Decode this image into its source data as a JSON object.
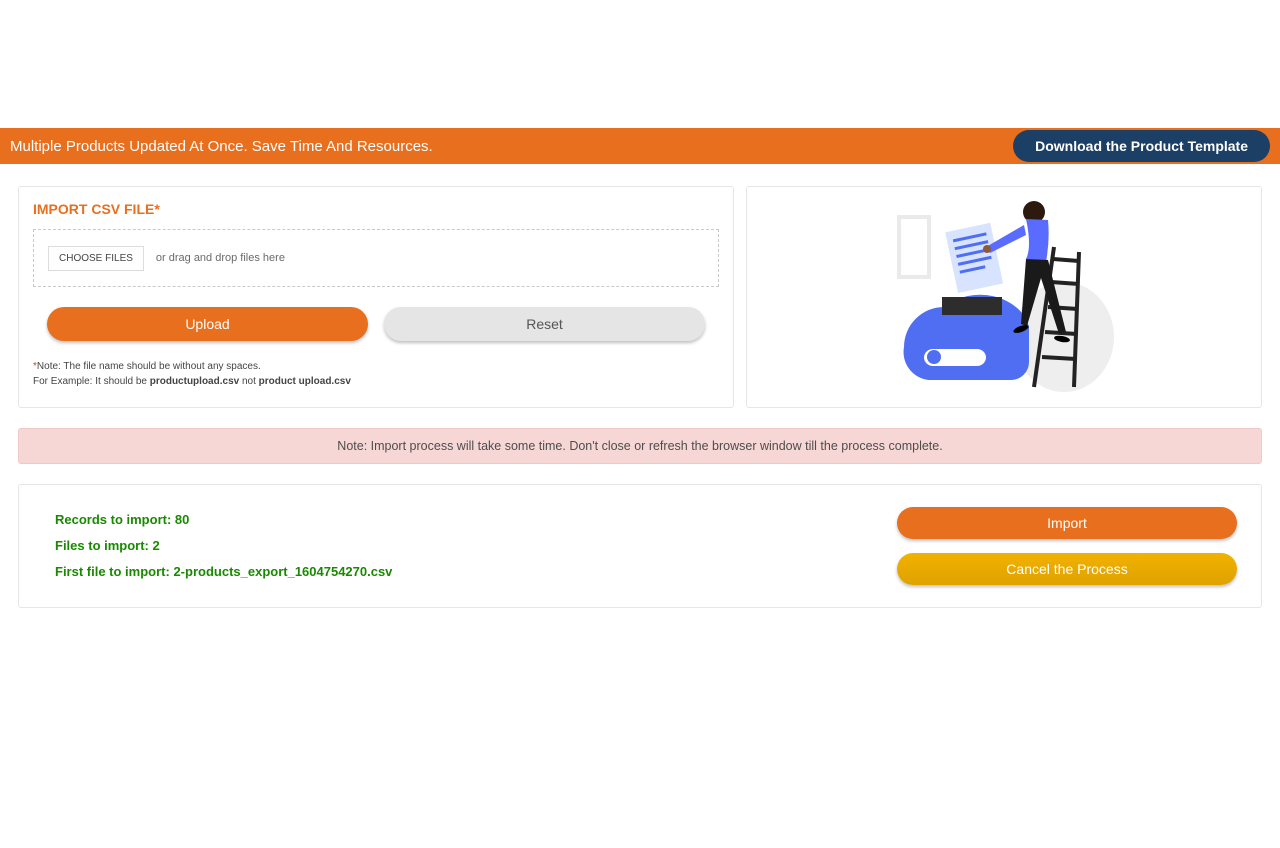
{
  "header": {
    "tagline": "Multiple Products Updated At Once. Save Time And Resources.",
    "download_label": "Download the Product Template"
  },
  "import_panel": {
    "title": "IMPORT CSV FILE*",
    "choose_files": "CHOOSE FILES",
    "drag_text": "or drag and drop files here",
    "upload_label": "Upload",
    "reset_label": "Reset",
    "note_prefix": "*",
    "note_line1": "Note: The file name should be without any spaces.",
    "note_line2_a": "For Example: It should be ",
    "note_good": "productupload.csv",
    "note_mid": " not ",
    "note_bad": "product upload.csv"
  },
  "alert": {
    "text": "Note: Import process will take some time. Don't close or refresh the browser window till the process complete."
  },
  "summary": {
    "records_label": "Records to import: ",
    "records_value": "80",
    "files_label": "Files to import: ",
    "files_value": "2",
    "first_file_label": "First file to import: ",
    "first_file_value": "2-products_export_1604754270.csv",
    "import_label": "Import",
    "cancel_label": "Cancel the Process"
  },
  "icons": {
    "upload_illustration": "upload-illustration"
  }
}
